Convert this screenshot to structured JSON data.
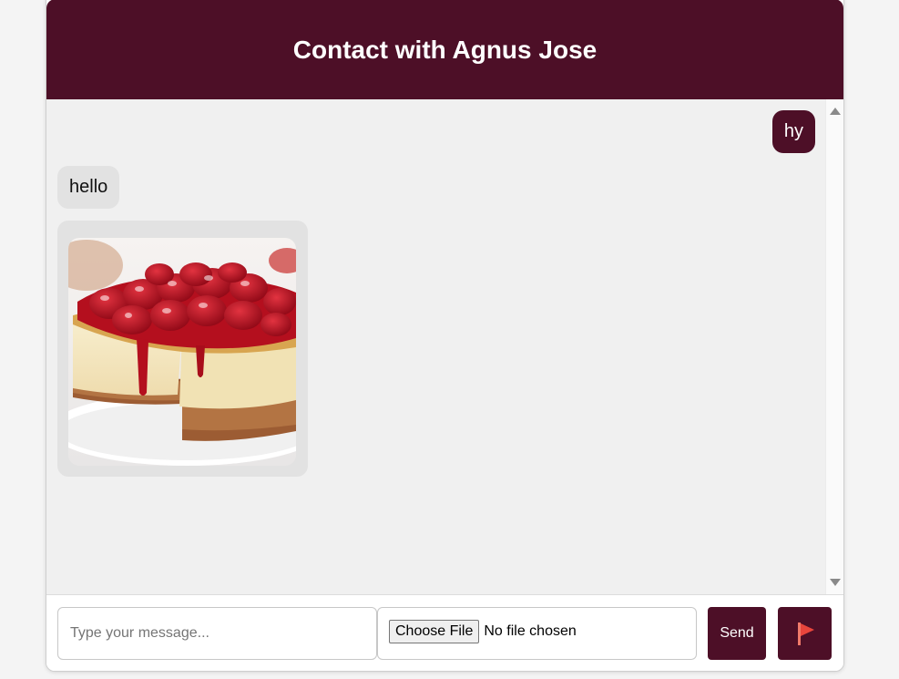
{
  "header": {
    "title": "Contact with Agnus Jose"
  },
  "messages": [
    {
      "direction": "outgoing",
      "text": "hy"
    },
    {
      "direction": "incoming",
      "text": "hello"
    },
    {
      "direction": "incoming",
      "type": "image",
      "image": "strawberry-cheesecake-photo"
    }
  ],
  "composer": {
    "placeholder": "Type your message...",
    "file_button_label": "Choose File",
    "file_status": "No file chosen",
    "send_label": "Send",
    "report_icon": "red-flag-icon"
  },
  "colors": {
    "brand": "#4d0f27",
    "chat_background": "#f0f0f0",
    "incoming_bubble": "#e2e2e2",
    "flag": "#e8453c"
  }
}
